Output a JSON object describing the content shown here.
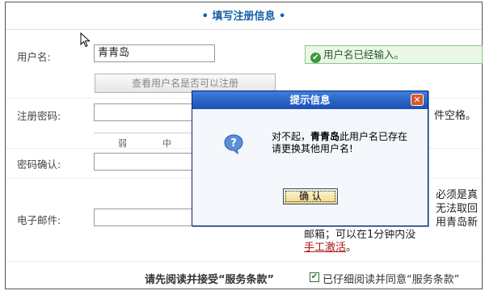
{
  "page_title": "• 填写注册信息 •",
  "username": {
    "label": "用户名:",
    "value": "青青岛",
    "check_button": "查看用户名是否可以注册",
    "status_text": "用户名已经输入。"
  },
  "password": {
    "label": "注册密码:",
    "hint_fragment": "件空格。",
    "strength_levels": [
      "弱",
      "中"
    ]
  },
  "confirm": {
    "label": "密码确认:"
  },
  "email": {
    "label": "电子邮件:",
    "note_lines": [
      "必须是真",
      "无法取回",
      "用青岛新"
    ],
    "note_tail": "邮箱；可以在1分钟内没",
    "manual_activate_link": "手工激活",
    "manual_activate_period": "。"
  },
  "agreement": {
    "label": "请先阅读并接受“服务条款”",
    "checkbox_text": "已仔细阅读并同意“服务条款”",
    "checked": true
  },
  "dialog": {
    "title": "提示信息",
    "message_line1_prefix": "对不起，",
    "message_line1_name": "青青岛",
    "message_line1_suffix": "此用户名已存在",
    "message_line2": "请更换其他用户名!",
    "ok_button": "确 认",
    "icon": "question-balloon-icon"
  },
  "colors": {
    "title_blue": "#1560a6",
    "ok_green": "#3a9a3a",
    "dialog_title_blue": "#1b4fb3",
    "link_red": "#b01010"
  }
}
